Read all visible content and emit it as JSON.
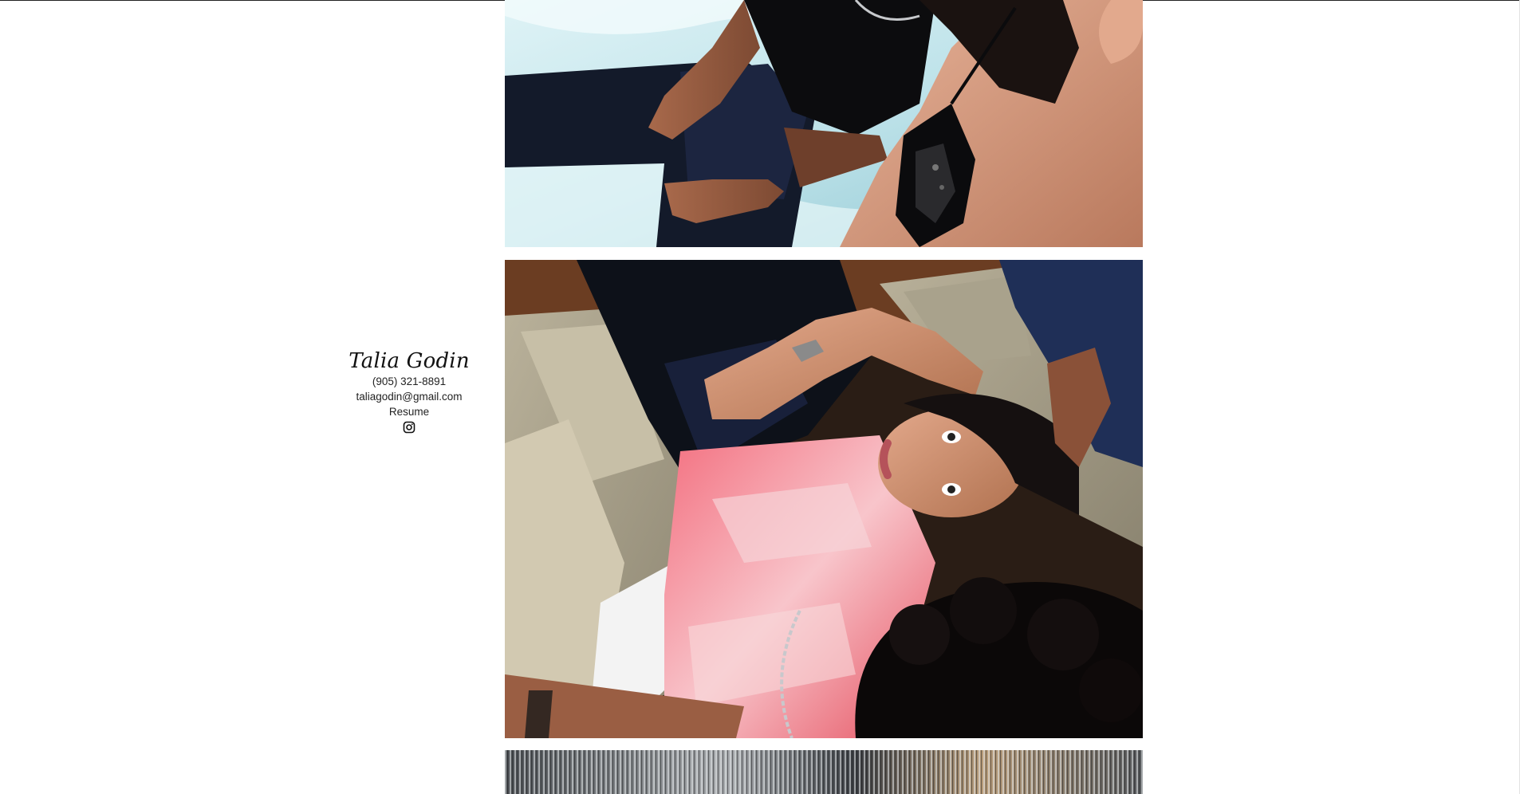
{
  "profile": {
    "name": "Talia Godin",
    "phone": "(905) 321-8891",
    "email": "taliagodin@gmail.com",
    "resume_label": "Resume",
    "social_icon": "instagram-icon"
  },
  "gallery": {
    "photos": [
      {
        "name": "photo-1",
        "desc": "bed"
      },
      {
        "name": "photo-2",
        "desc": "couch"
      },
      {
        "name": "photo-3",
        "desc": "sparkle"
      }
    ]
  },
  "colors": {
    "background": "#ffffff",
    "text": "#111111"
  }
}
